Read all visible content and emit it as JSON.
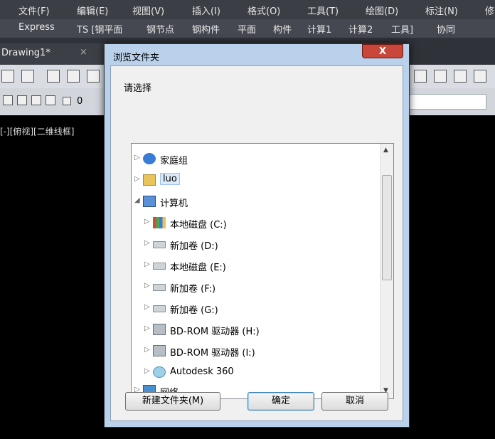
{
  "menubar": [
    "文件(F)",
    "编辑(E)",
    "视图(V)",
    "插入(I)",
    "格式(O)",
    "工具(T)",
    "绘图(D)",
    "标注(N)",
    "修"
  ],
  "toolbar2": [
    "Express",
    "TS [钢平面",
    "钢节点",
    "钢构件",
    "平面",
    "构件",
    "计算1",
    "计算2",
    "工具]",
    "协同"
  ],
  "doc_tab": {
    "title": "Drawing1*",
    "close": "×"
  },
  "layer": {
    "value": "0"
  },
  "viewport_label": "[-][俯视][二维线框]",
  "dialog": {
    "title": "浏览文件夹",
    "close": "X",
    "prompt": "请选择",
    "tree": [
      {
        "label": "家庭组",
        "icon": "homegroup-icon",
        "arrow": "▷"
      },
      {
        "label": "luo",
        "icon": "user-folder-icon",
        "arrow": "▷",
        "selected": true
      },
      {
        "label": "计算机",
        "icon": "computer-icon",
        "arrow": "◢"
      },
      {
        "label": "本地磁盘 (C:)",
        "icon": "system-drive-icon",
        "arrow": "▷"
      },
      {
        "label": "新加卷 (D:)",
        "icon": "drive-icon",
        "arrow": "▷"
      },
      {
        "label": "本地磁盘 (E:)",
        "icon": "drive-icon",
        "arrow": "▷"
      },
      {
        "label": "新加卷 (F:)",
        "icon": "drive-icon",
        "arrow": "▷"
      },
      {
        "label": "新加卷 (G:)",
        "icon": "drive-icon",
        "arrow": "▷"
      },
      {
        "label": "BD-ROM 驱动器 (H:)",
        "icon": "optical-drive-icon",
        "arrow": "▷"
      },
      {
        "label": "BD-ROM 驱动器 (I:)",
        "icon": "optical-drive-icon",
        "arrow": "▷"
      },
      {
        "label": "Autodesk 360",
        "icon": "cloud-icon",
        "arrow": "▷"
      },
      {
        "label": "网络",
        "icon": "network-icon",
        "arrow": "▷"
      }
    ],
    "buttons": {
      "new_folder": "新建文件夹(M)",
      "ok": "确定",
      "cancel": "取消"
    }
  }
}
